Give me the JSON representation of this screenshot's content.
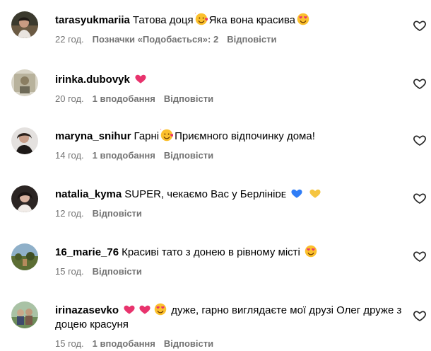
{
  "comments": [
    {
      "username": "tarasyukmariia",
      "text_parts": [
        "Татова доця",
        "Яка вона красива",
        ""
      ],
      "time": "22 год.",
      "likes": "Позначки «Подобається»: 2",
      "reply": "Відповісти",
      "emojis": [
        "smiling-face-with-hearts",
        "heart-eyes"
      ]
    },
    {
      "username": "irinka.dubovyk",
      "text_parts": [
        "",
        ""
      ],
      "time": "20 год.",
      "likes": "1 вподобання",
      "reply": "Відповісти",
      "emojis": [
        "pink-heart"
      ]
    },
    {
      "username": "maryna_snihur",
      "text_parts": [
        "Гарні",
        "Приємного відпочинку дома!"
      ],
      "time": "14 год.",
      "likes": "1 вподобання",
      "reply": "Відповісти",
      "emojis": [
        "smiling-face-with-hearts"
      ]
    },
    {
      "username": "natalia_kyma",
      "text_parts": [
        "SUPER, чекаємо Вас у Берлініᴅᴇ",
        "",
        ""
      ],
      "time": "12 год.",
      "likes": "",
      "reply": "Відповісти",
      "emojis": [
        "blue-heart",
        "yellow-heart"
      ]
    },
    {
      "username": "16_marie_76",
      "text_parts": [
        "Красиві тато з донею в рівному місті",
        ""
      ],
      "time": "15 год.",
      "likes": "",
      "reply": "Відповісти",
      "emojis": [
        "heart-eyes"
      ]
    },
    {
      "username": "irinazasevko",
      "text_parts": [
        "",
        "",
        "",
        "дуже, гарно виглядаєте мої друзі Олег друже з доцею красуня"
      ],
      "time": "15 год.",
      "likes": "1 вподобання",
      "reply": "Відповісти",
      "emojis": [
        "pink-heart",
        "pink-heart",
        "heart-eyes"
      ]
    }
  ],
  "colors": {
    "text": "#000000",
    "meta": "#737373",
    "emoji_pink": "#e8336d",
    "emoji_blue": "#2f7df6",
    "emoji_yellow": "#f5c542",
    "emoji_face": "#fbc02d"
  }
}
